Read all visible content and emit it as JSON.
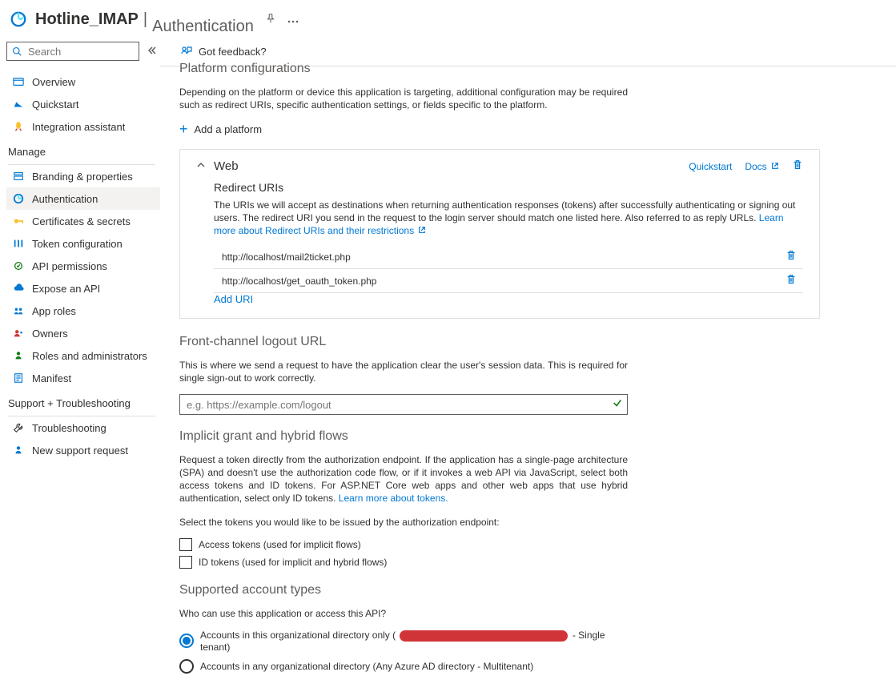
{
  "header": {
    "app_name": "Hotline_IMAP",
    "section": "Authentication"
  },
  "search": {
    "placeholder": "Search"
  },
  "sidebar": {
    "top": [
      {
        "label": "Overview"
      },
      {
        "label": "Quickstart"
      },
      {
        "label": "Integration assistant"
      }
    ],
    "manage_label": "Manage",
    "manage": [
      {
        "label": "Branding & properties"
      },
      {
        "label": "Authentication",
        "selected": true
      },
      {
        "label": "Certificates & secrets"
      },
      {
        "label": "Token configuration"
      },
      {
        "label": "API permissions"
      },
      {
        "label": "Expose an API"
      },
      {
        "label": "App roles"
      },
      {
        "label": "Owners"
      },
      {
        "label": "Roles and administrators"
      },
      {
        "label": "Manifest"
      }
    ],
    "support_label": "Support + Troubleshooting",
    "support": [
      {
        "label": "Troubleshooting"
      },
      {
        "label": "New support request"
      }
    ]
  },
  "feedback": "Got feedback?",
  "platform": {
    "heading": "Platform configurations",
    "desc": "Depending on the platform or device this application is targeting, additional configuration may be required such as redirect URIs, specific authentication settings, or fields specific to the platform.",
    "add_label": "Add a platform"
  },
  "web_card": {
    "title": "Web",
    "quickstart_link": "Quickstart",
    "docs_link": "Docs",
    "redirect_heading": "Redirect URIs",
    "redirect_desc": "The URIs we will accept as destinations when returning authentication responses (tokens) after successfully authenticating or signing out users. The redirect URI you send in the request to the login server should match one listed here. Also referred to as reply URLs. ",
    "learn_link": "Learn more about Redirect URIs and their restrictions",
    "uris": [
      "http://localhost/mail2ticket.php",
      "http://localhost/get_oauth_token.php"
    ],
    "add_uri": "Add URI"
  },
  "logout": {
    "heading": "Front-channel logout URL",
    "desc": "This is where we send a request to have the application clear the user's session data. This is required for single sign-out to work correctly.",
    "placeholder": "e.g. https://example.com/logout"
  },
  "implicit": {
    "heading": "Implicit grant and hybrid flows",
    "desc": "Request a token directly from the authorization endpoint. If the application has a single-page architecture (SPA) and doesn't use the authorization code flow, or if it invokes a web API via JavaScript, select both access tokens and ID tokens. For ASP.NET Core web apps and other web apps that use hybrid authentication, select only ID tokens. ",
    "learn_link": "Learn more about tokens.",
    "select_label": "Select the tokens you would like to be issued by the authorization endpoint:",
    "access_label": "Access tokens (used for implicit flows)",
    "id_label": "ID tokens (used for implicit and hybrid flows)"
  },
  "account": {
    "heading": "Supported account types",
    "who": "Who can use this application or access this API?",
    "opt1_prefix": "Accounts in this organizational directory only (",
    "opt1_suffix": " - Single tenant)",
    "opt2": "Accounts in any organizational directory (Any Azure AD directory - Multitenant)"
  }
}
